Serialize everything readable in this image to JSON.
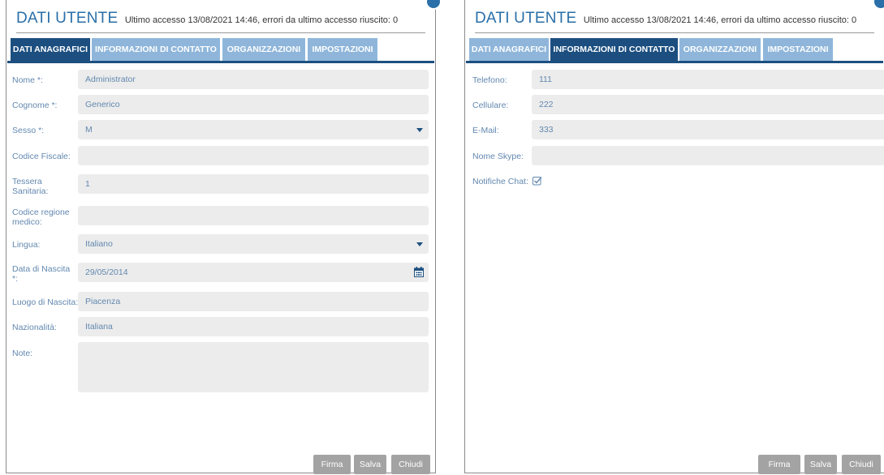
{
  "header": {
    "title": "DATI UTENTE",
    "subtitle": "Ultimo accesso 13/08/2021 14:46, errori da ultimo accesso riuscito: 0"
  },
  "tabs": [
    {
      "label": "DATI ANAGRAFICI"
    },
    {
      "label": "INFORMAZIONI DI CONTATTO"
    },
    {
      "label": "ORGANIZZAZIONI"
    },
    {
      "label": "IMPOSTAZIONI"
    }
  ],
  "anagrafici": {
    "nome": {
      "label": "Nome *:",
      "value": "Administrator"
    },
    "cognome": {
      "label": "Cognome *:",
      "value": "Generico"
    },
    "sesso": {
      "label": "Sesso *:",
      "value": "M"
    },
    "codice_fiscale": {
      "label": "Codice Fiscale:",
      "value": ""
    },
    "tessera": {
      "label_line1": "Tessera",
      "label_line2": "Sanitaria:",
      "value": "1"
    },
    "codice_regione": {
      "label_line1": "Codice regione",
      "label_line2": "medico:",
      "value": ""
    },
    "lingua": {
      "label": "Lingua:",
      "value": "Italiano"
    },
    "data_nascita": {
      "label_line1": "Data di Nascita",
      "label_line2": "*:",
      "value": "29/05/2014"
    },
    "luogo_nascita": {
      "label": "Luogo di Nascita:",
      "value": "Piacenza"
    },
    "nazionalita": {
      "label": "Nazionalità:",
      "value": "Italiana"
    },
    "note": {
      "label": "Note:",
      "value": ""
    }
  },
  "contatto": {
    "telefono": {
      "label": "Telefono:",
      "value": "111"
    },
    "cellulare": {
      "label": "Cellulare:",
      "value": "222"
    },
    "email": {
      "label": "E-Mail:",
      "value": "333"
    },
    "skype": {
      "label": "Nome Skype:",
      "value": ""
    },
    "notifiche": {
      "label": "Notifiche Chat:",
      "checked": true
    }
  },
  "buttons": {
    "firma": "Firma",
    "salva": "Salva",
    "chiudi": "Chiudi"
  },
  "colors": {
    "accent": "#2a6fa8",
    "tab_active": "#1c4f80",
    "tab_inactive": "#8fb6da",
    "label": "#6288b0",
    "field_bg": "#ececec",
    "button_bg": "#a3a3a3"
  },
  "icons": [
    "chevron-down-icon",
    "calendar-icon",
    "checkbox-checked-icon"
  ]
}
